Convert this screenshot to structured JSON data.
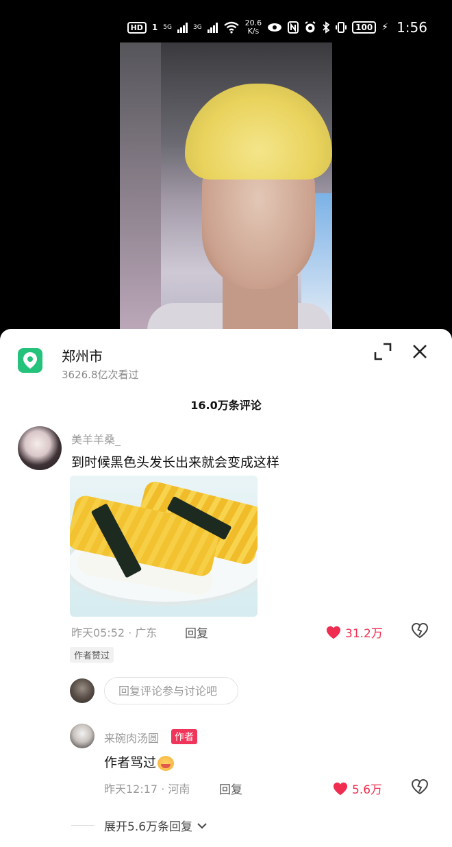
{
  "status_bar": {
    "hd": "HD",
    "sim1": "1",
    "net1": "5G",
    "net2": "3G",
    "speed_value": "20.6",
    "speed_unit": "K/s",
    "battery": "100",
    "time": "1:56"
  },
  "location": {
    "name": "郑州市",
    "views": "3626.8亿次看过"
  },
  "comments_header": {
    "count": "16.0万条评论"
  },
  "comment": {
    "username": "美羊羊桑_",
    "text": "到时候黑色头发长出来就会变成这样",
    "time_location": "昨天05:52 · 广东",
    "reply_label": "回复",
    "likes": "31.2万",
    "author_badge": "作者赞过"
  },
  "reply_input": {
    "placeholder": "回复评论参与讨论吧"
  },
  "reply": {
    "username": "来碗肉汤圆",
    "author_tag": "作者",
    "text": "作者骂过",
    "time_location": "昨天12:17 · 河南",
    "reply_label": "回复",
    "likes": "5.6万"
  },
  "expand": {
    "label": "展开5.6万条回复"
  },
  "colors": {
    "accent_red": "#f02d50",
    "location_green": "#24c27a"
  }
}
